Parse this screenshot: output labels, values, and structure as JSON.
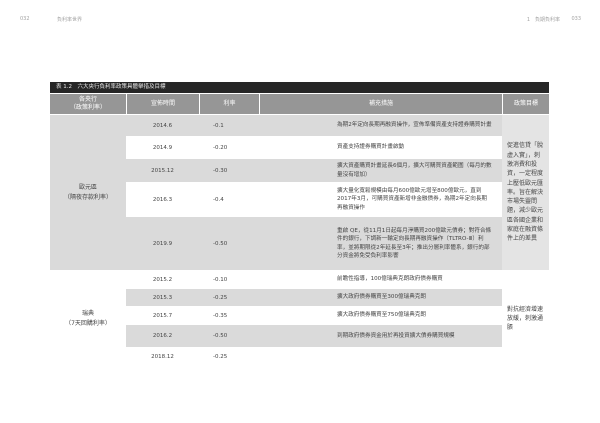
{
  "running_header": {
    "left_page_number": "032",
    "left_title": "負利率世界",
    "right_title": "1　負期負利率",
    "right_page_number": "033"
  },
  "table": {
    "title": "表 1.2　六大央行負利率政策具體舉措及目標",
    "columns": {
      "bank_line1": "各央行",
      "bank_line2": "（政策利率）",
      "date": "宣佈時間",
      "rate": "利率",
      "measures": "補充措施",
      "goal": "政策目標"
    },
    "groups": [
      {
        "bank_name": "歐元區",
        "bank_policy_rate": "（隔夜存款利率）",
        "goal": "促進信貸「脫虛入實」，刺激消費和投資，一定程度上壓低歐元匯率。旨在解決市場失靈問題，減少歐元區各國企業和家庭在融資條件上的差異",
        "rows": [
          {
            "date": "2014.6",
            "rate": "-0.1",
            "measures": "為期2年定向長期再融資操作，宣佈準備資產支持證券購買計畫"
          },
          {
            "date": "2014.9",
            "rate": "-0.20",
            "measures": "資產支持證券購買計畫啟動"
          },
          {
            "date": "2015.12",
            "rate": "-0.30",
            "measures": "擴大資產購買計畫延長6個月，擴大可購買資產範圍（每月的數量沒有增加）"
          },
          {
            "date": "2016.3",
            "rate": "-0.4",
            "measures": "擴大量化寬鬆規模由每月600億歐元增至800億歐元，直到2017年3月，可購買資產新增非金融債券，為期2年定向長期再融資操作"
          },
          {
            "date": "2019.9",
            "rate": "-0.50",
            "measures": "重啟 QE，從11月1日起每月淨購買200億歐元債券；對符合條件的銀行，下調新一輪定向長期再融資操作（TLTRO-Ⅲ）利率，並將期限從2年延長至3年；推出分層利率體系，銀行的部分資金將免受負利率影響"
          }
        ]
      },
      {
        "bank_name": "瑞典",
        "bank_policy_rate": "（7天回購利率）",
        "goal": "對抗經濟增速放緩，刺激通脹",
        "rows": [
          {
            "date": "2015.2",
            "rate": "-0.10",
            "measures": "前瞻性指導，100億瑞典克朗政府債券購買"
          },
          {
            "date": "2015.3",
            "rate": "-0.25",
            "measures": "擴大政府債券購買至300億瑞典克朗"
          },
          {
            "date": "2015.7",
            "rate": "-0.35",
            "measures": "擴大政府債券購買至750億瑞典克朗"
          },
          {
            "date": "2016.2",
            "rate": "-0.50",
            "measures": "到期政府債券資金用於再投資擴大債券購買規模"
          },
          {
            "date": "2018.12",
            "rate": "-0.25",
            "measures": ""
          }
        ]
      }
    ]
  }
}
